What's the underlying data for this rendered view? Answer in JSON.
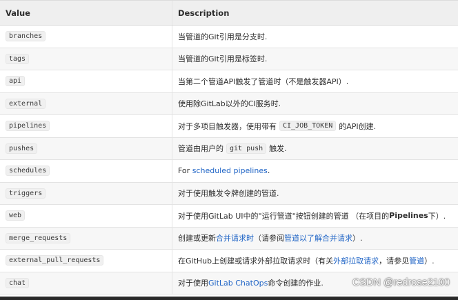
{
  "header": {
    "value_label": "Value",
    "description_label": "Description"
  },
  "rows": [
    {
      "value": "branches",
      "desc": [
        "当管道的Git引用是分支时."
      ]
    },
    {
      "value": "tags",
      "desc": [
        "当管道的Git引用是标签时."
      ]
    },
    {
      "value": "api",
      "desc": [
        "当第二个管道API触发了管道时（不是触发器API）."
      ]
    },
    {
      "value": "external",
      "desc": [
        "使用除GitLab以外的CI服务时."
      ]
    },
    {
      "value": "pipelines",
      "desc": [
        "对于多项目触发器，使用带有",
        "CI_JOB_TOKEN",
        "的API创建."
      ]
    },
    {
      "value": "pushes",
      "desc": [
        "管道由用户的",
        "git push",
        "触发."
      ]
    },
    {
      "value": "schedules",
      "desc": [
        "For",
        "scheduled pipelines",
        "."
      ]
    },
    {
      "value": "triggers",
      "desc": [
        "对于使用触发令牌创建的管道."
      ]
    },
    {
      "value": "web",
      "desc": [
        "对于使用GitLab UI中的\"运行管道\"按钮创建的管道 （在项目的",
        "Pipelines",
        "下）."
      ]
    },
    {
      "value": "merge_requests",
      "desc": [
        "创建或更新",
        "合并请求时",
        "（请参阅",
        "管道以了解合并请求",
        "）."
      ]
    },
    {
      "value": "external_pull_requests",
      "desc": [
        "在GitHub上创建或请求外部拉取请求时（有关",
        "外部拉取请求",
        "，请参见",
        "管道",
        "）."
      ]
    },
    {
      "value": "chat",
      "desc": [
        "对于使用",
        "GitLab ChatOps",
        "命令创建的作业."
      ]
    }
  ],
  "watermark": "CSDN @redrose2100",
  "colors": {
    "link": "#1f64c6",
    "text": "#2e2e2e",
    "code_bg": "#f0f0f0"
  }
}
